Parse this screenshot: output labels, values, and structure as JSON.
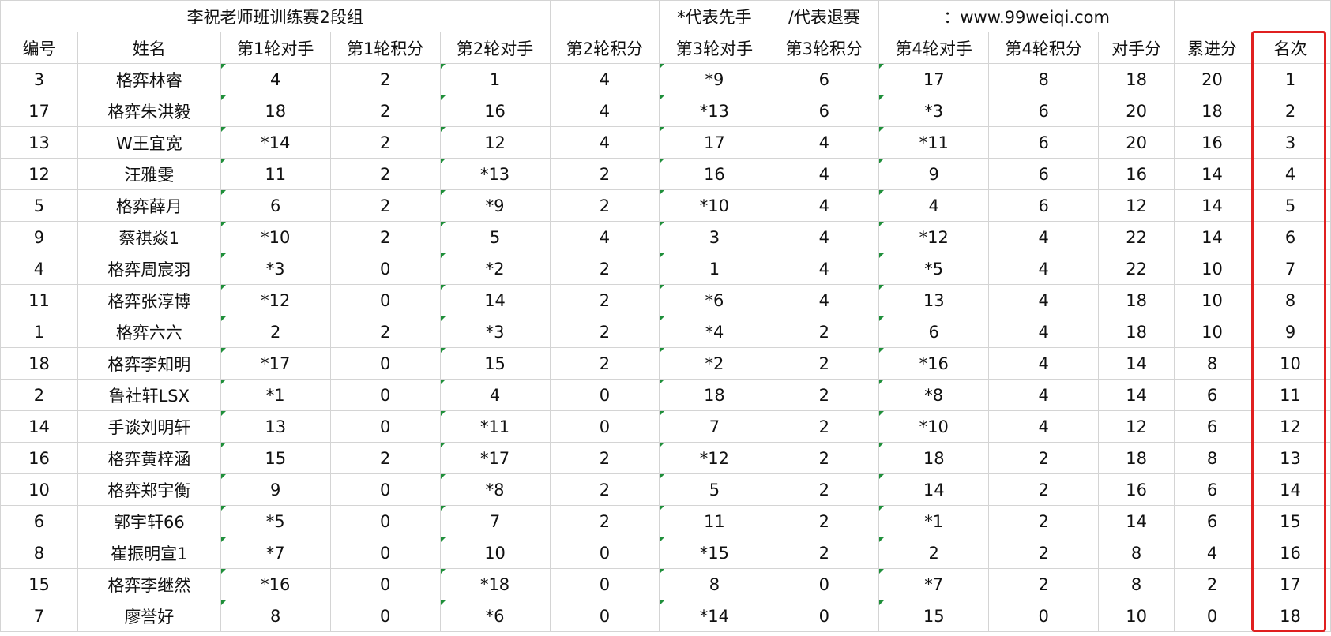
{
  "title_row": {
    "title": "李祝老师班训练赛2段组",
    "note_first": "*代表先手",
    "note_quit": "/代表退赛",
    "site": "：www.99weiqi.com"
  },
  "headers": [
    "编号",
    "姓名",
    "第1轮对手",
    "第1轮积分",
    "第2轮对手",
    "第2轮积分",
    "第3轮对手",
    "第3轮积分",
    "第4轮对手",
    "第4轮积分",
    "对手分",
    "累进分",
    "名次"
  ],
  "rows": [
    [
      "3",
      "格弈林睿",
      "4",
      "2",
      "1",
      "4",
      "*9",
      "6",
      "17",
      "8",
      "18",
      "20",
      "1"
    ],
    [
      "17",
      "格弈朱洪毅",
      "18",
      "2",
      "16",
      "4",
      "*13",
      "6",
      "*3",
      "6",
      "20",
      "18",
      "2"
    ],
    [
      "13",
      "W王宜宽",
      "*14",
      "2",
      "12",
      "4",
      "17",
      "4",
      "*11",
      "6",
      "20",
      "16",
      "3"
    ],
    [
      "12",
      "汪雅雯",
      "11",
      "2",
      "*13",
      "2",
      "16",
      "4",
      "9",
      "6",
      "16",
      "14",
      "4"
    ],
    [
      "5",
      "格弈薛月",
      "6",
      "2",
      "*9",
      "2",
      "*10",
      "4",
      "4",
      "6",
      "12",
      "14",
      "5"
    ],
    [
      "9",
      "蔡祺焱1",
      "*10",
      "2",
      "5",
      "4",
      "3",
      "4",
      "*12",
      "4",
      "22",
      "14",
      "6"
    ],
    [
      "4",
      "格弈周宸羽",
      "*3",
      "0",
      "*2",
      "2",
      "1",
      "4",
      "*5",
      "4",
      "22",
      "10",
      "7"
    ],
    [
      "11",
      "格弈张淳博",
      "*12",
      "0",
      "14",
      "2",
      "*6",
      "4",
      "13",
      "4",
      "18",
      "10",
      "8"
    ],
    [
      "1",
      "格弈六六",
      "2",
      "2",
      "*3",
      "2",
      "*4",
      "2",
      "6",
      "4",
      "18",
      "10",
      "9"
    ],
    [
      "18",
      "格弈李知明",
      "*17",
      "0",
      "15",
      "2",
      "*2",
      "2",
      "*16",
      "4",
      "14",
      "8",
      "10"
    ],
    [
      "2",
      "鲁社轩LSX",
      "*1",
      "0",
      "4",
      "0",
      "18",
      "2",
      "*8",
      "4",
      "14",
      "6",
      "11"
    ],
    [
      "14",
      "手谈刘明轩",
      "13",
      "0",
      "*11",
      "0",
      "7",
      "2",
      "*10",
      "4",
      "12",
      "6",
      "12"
    ],
    [
      "16",
      "格弈黄梓涵",
      "15",
      "2",
      "*17",
      "2",
      "*12",
      "2",
      "18",
      "2",
      "18",
      "8",
      "13"
    ],
    [
      "10",
      "格弈郑宇衡",
      "9",
      "0",
      "*8",
      "2",
      "5",
      "2",
      "14",
      "2",
      "16",
      "6",
      "14"
    ],
    [
      "6",
      "郭宇轩66",
      "*5",
      "0",
      "7",
      "2",
      "11",
      "2",
      "*1",
      "2",
      "14",
      "6",
      "15"
    ],
    [
      "8",
      "崔振明宣1",
      "*7",
      "0",
      "10",
      "0",
      "*15",
      "2",
      "2",
      "2",
      "8",
      "4",
      "16"
    ],
    [
      "15",
      "格弈李继然",
      "*16",
      "0",
      "*18",
      "0",
      "8",
      "0",
      "*7",
      "2",
      "8",
      "2",
      "17"
    ],
    [
      "7",
      "廖誉好",
      "8",
      "0",
      "*6",
      "0",
      "*14",
      "0",
      "15",
      "0",
      "10",
      "0",
      "18"
    ]
  ],
  "colors": {
    "grid": "#d4d4d4",
    "highlight": "#e02020",
    "marker": "#1f8f3a"
  }
}
